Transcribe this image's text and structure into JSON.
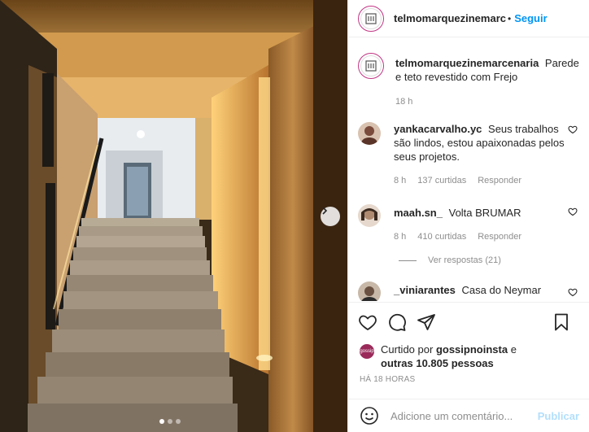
{
  "post": {
    "author": "telmomarquezinemarcenaria",
    "follow_label": "Seguir",
    "separator": "•",
    "avatar_label": "MARCENARIA",
    "caption_text": "Parede e teto revestido com Frejo",
    "caption_time": "18 h"
  },
  "comments": [
    {
      "username": "yankacarvalho.yc",
      "text": "Seus trabalhos são lindos, estou apaixonadas pelos seus projetos.",
      "time": "8 h",
      "likes": "137 curtidas",
      "reply_label": "Responder",
      "avatar_color": "#7a4a3a"
    },
    {
      "username": "maah.sn_",
      "text": "Volta BRUMAR",
      "time": "8 h",
      "likes": "410 curtidas",
      "reply_label": "Responder",
      "view_replies": "Ver respostas (21)",
      "avatar_color": "#a07a60"
    },
    {
      "username": "_viniarantes",
      "text": "Casa do Neymar",
      "avatar_color": "#6a5040"
    }
  ],
  "likes_summary": {
    "prefix": "Curtido por",
    "user": "gossipnoinsta",
    "connector": "e",
    "others": "outras 10.805 pessoas",
    "badge_text": "gossip"
  },
  "timestamp": "HÁ 18 HORAS",
  "add_comment": {
    "placeholder": "Adicione um comentário...",
    "publish_label": "Publicar"
  },
  "carousel": {
    "total": 3,
    "active": 1
  },
  "colors": {
    "accent": "#0095f6",
    "publish_disabled": "#b2dffc",
    "ring": "#c13584"
  },
  "icons": [
    "heart-icon",
    "comment-icon",
    "share-icon",
    "bookmark-icon",
    "emoji-icon",
    "chevron-right-icon"
  ]
}
